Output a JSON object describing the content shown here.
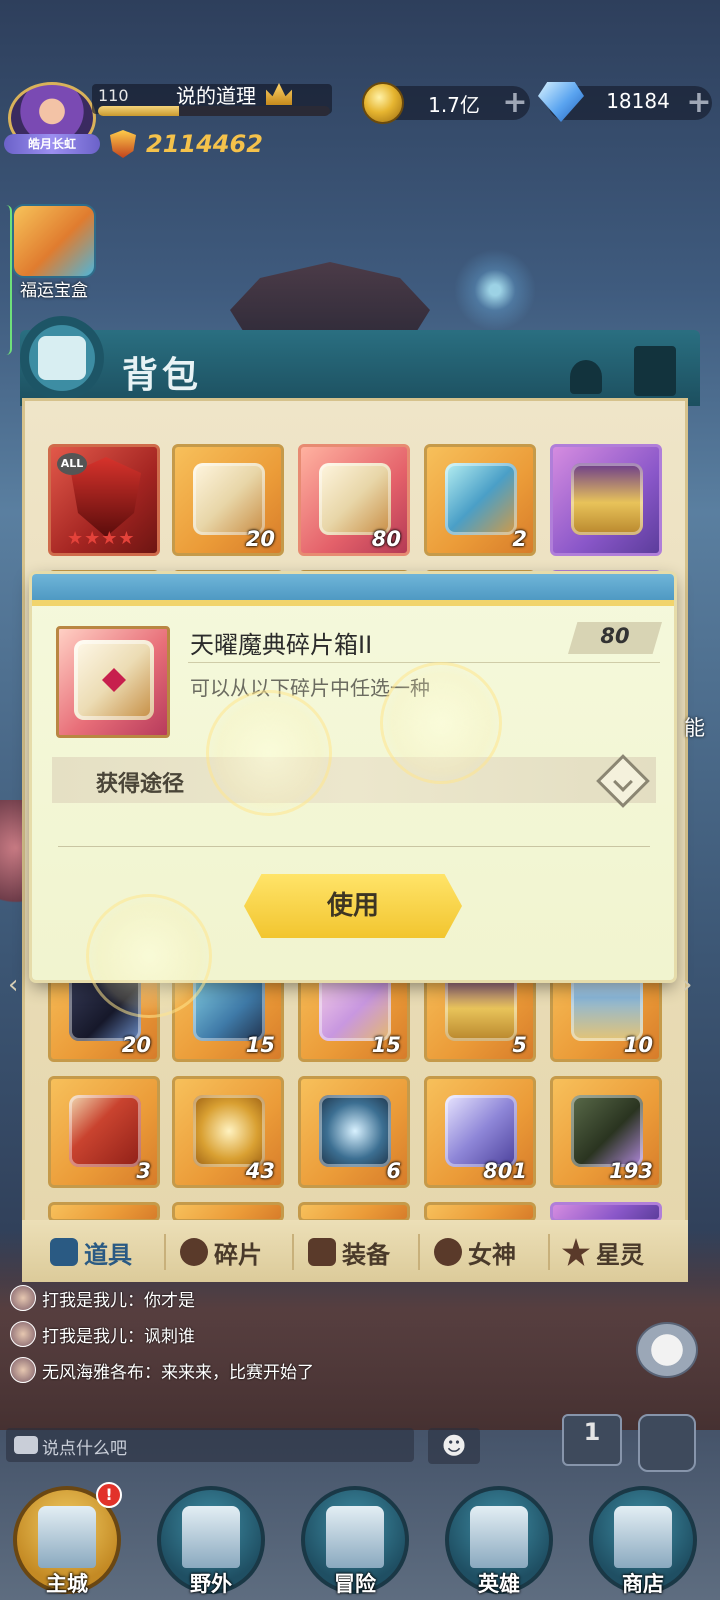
{
  "player": {
    "avatar_title": "皓月长虹",
    "level": "110",
    "name": "说的道理",
    "exp_progress": 0.35,
    "power": "2114462"
  },
  "currency": {
    "gold": "1.7亿",
    "gems": "18184",
    "plus": "+"
  },
  "side": {
    "lucky_box_label": "福运宝盒",
    "right_label": "能"
  },
  "bag": {
    "title": "背包",
    "row1": [
      {
        "icon": "demon-mask-icon",
        "badge": "ALL",
        "stars": "★★★★",
        "qty": ""
      },
      {
        "icon": "white-chest-icon",
        "qty": "20"
      },
      {
        "icon": "grimoire-fragment-box-icon",
        "qty": "80"
      },
      {
        "icon": "crystal-icon",
        "qty": "2"
      },
      {
        "icon": "gold-chest-icon",
        "qty": ""
      }
    ],
    "row3": [
      {
        "icon": "dark-wolf-icon",
        "qty": "20"
      },
      {
        "icon": "card-pack-icon",
        "qty": "15"
      },
      {
        "icon": "puzzle-piece-icon",
        "qty": "15"
      },
      {
        "icon": "purple-chest-icon",
        "qty": "5"
      },
      {
        "icon": "orb-chest-icon",
        "qty": "10"
      }
    ],
    "row4": [
      {
        "icon": "red-card-icon",
        "qty": "3"
      },
      {
        "icon": "golden-compass-icon",
        "qty": "43"
      },
      {
        "icon": "ship-wheel-icon",
        "qty": "6"
      },
      {
        "icon": "purple-crystal-shard-icon",
        "qty": "801"
      },
      {
        "icon": "green-scroll-icon",
        "qty": "193"
      }
    ],
    "tabs": [
      "道具",
      "碎片",
      "装备",
      "女神",
      "星灵"
    ]
  },
  "dialog": {
    "item_title": "天曜魔典碎片箱II",
    "count": "80",
    "description": "可以从以下碎片中任选一种",
    "source_label": "获得途径",
    "use_button": "使用"
  },
  "chat": {
    "lines": [
      {
        "text": "打我是我儿：你才是"
      },
      {
        "text": "打我是我儿：讽刺谁"
      },
      {
        "text": "无风海雅各布：来来来，比赛开始了"
      }
    ],
    "placeholder": "说点什么吧",
    "emoji": "☻",
    "rank_number": "1"
  },
  "nav": [
    {
      "label": "主城",
      "badge": "!"
    },
    {
      "label": "野外"
    },
    {
      "label": "冒险"
    },
    {
      "label": "英雄"
    },
    {
      "label": "商店"
    }
  ],
  "colors": {
    "accent_gold": "#f5c24b",
    "panel_teal": "#2a6f81",
    "use_button": "#f2c52f"
  }
}
